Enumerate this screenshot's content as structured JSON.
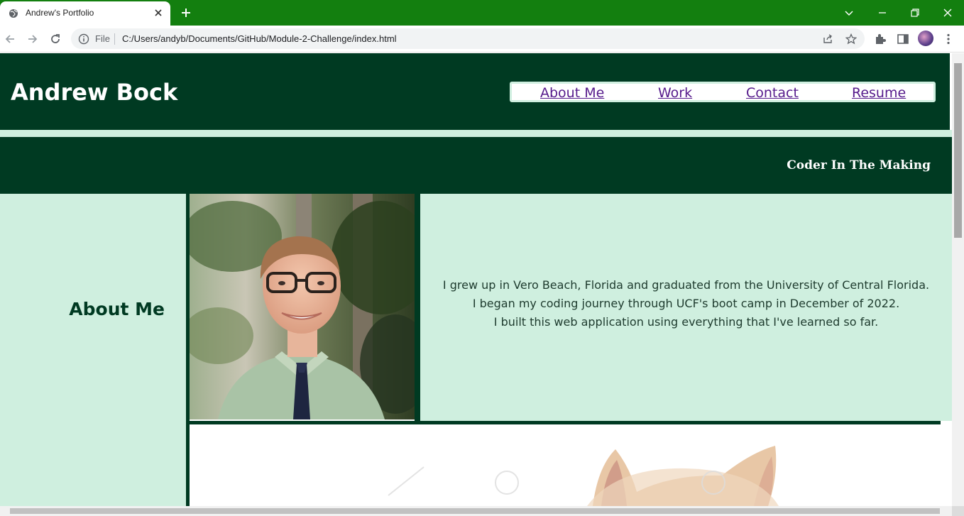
{
  "browser": {
    "tab_title": "Andrew's Portfolio",
    "url_scheme": "File",
    "url": "C:/Users/andyb/Documents/GitHub/Module-2-Challenge/index.html"
  },
  "page": {
    "site_title": "Andrew Bock",
    "nav": [
      {
        "label": "About Me"
      },
      {
        "label": "Work"
      },
      {
        "label": "Contact"
      },
      {
        "label": "Resume"
      }
    ],
    "tagline": "Coder In The Making",
    "about": {
      "heading": "About Me",
      "bio_lines": [
        "I grew up in Vero Beach, Florida and graduated from the University of Central Florida.",
        "I began my coding journey through UCF's boot camp in December of 2022.",
        "I built this web application using everything that I've learned so far."
      ]
    }
  },
  "colors": {
    "tab_strip": "#137f0f",
    "header_bg": "#003a22",
    "light_mint": "#cfefdf",
    "link_visited": "#551a8b"
  }
}
